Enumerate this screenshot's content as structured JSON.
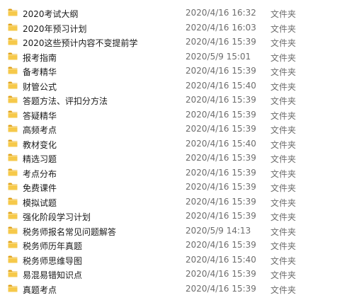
{
  "files": [
    {
      "name": "2020考试大纲",
      "date": "2020/4/16 16:32",
      "type": "文件夹",
      "icon": "folder-icon"
    },
    {
      "name": "2020年预习计划",
      "date": "2020/4/16 16:03",
      "type": "文件夹",
      "icon": "folder-icon"
    },
    {
      "name": "2020这些预计内容不变提前学",
      "date": "2020/4/16 15:39",
      "type": "文件夹",
      "icon": "folder-icon"
    },
    {
      "name": "报考指南",
      "date": "2020/5/9 15:01",
      "type": "文件夹",
      "icon": "folder-icon"
    },
    {
      "name": "备考精华",
      "date": "2020/4/16 15:39",
      "type": "文件夹",
      "icon": "folder-icon"
    },
    {
      "name": "财管公式",
      "date": "2020/4/16 15:40",
      "type": "文件夹",
      "icon": "folder-icon"
    },
    {
      "name": "答题方法、评扣分方法",
      "date": "2020/4/16 15:39",
      "type": "文件夹",
      "icon": "folder-icon"
    },
    {
      "name": "答疑精华",
      "date": "2020/4/16 15:39",
      "type": "文件夹",
      "icon": "folder-icon"
    },
    {
      "name": "高频考点",
      "date": "2020/4/16 15:39",
      "type": "文件夹",
      "icon": "folder-icon"
    },
    {
      "name": "教材变化",
      "date": "2020/4/16 15:40",
      "type": "文件夹",
      "icon": "folder-icon"
    },
    {
      "name": "精选习题",
      "date": "2020/4/16 15:39",
      "type": "文件夹",
      "icon": "folder-icon"
    },
    {
      "name": "考点分布",
      "date": "2020/4/16 15:39",
      "type": "文件夹",
      "icon": "folder-icon"
    },
    {
      "name": "免费课件",
      "date": "2020/4/16 15:39",
      "type": "文件夹",
      "icon": "folder-icon"
    },
    {
      "name": "模拟试题",
      "date": "2020/4/16 15:39",
      "type": "文件夹",
      "icon": "folder-icon"
    },
    {
      "name": "强化阶段学习计划",
      "date": "2020/4/16 15:39",
      "type": "文件夹",
      "icon": "folder-icon"
    },
    {
      "name": "税务师报名常见问题解答",
      "date": "2020/5/9 14:13",
      "type": "文件夹",
      "icon": "folder-icon"
    },
    {
      "name": "税务师历年真题",
      "date": "2020/4/16 15:39",
      "type": "文件夹",
      "icon": "folder-icon"
    },
    {
      "name": "税务师思维导图",
      "date": "2020/4/16 15:40",
      "type": "文件夹",
      "icon": "folder-icon"
    },
    {
      "name": "易混易错知识点",
      "date": "2020/4/16 15:39",
      "type": "文件夹",
      "icon": "folder-icon"
    },
    {
      "name": "真题考点",
      "date": "2020/4/16 15:39",
      "type": "文件夹",
      "icon": "folder-icon"
    }
  ]
}
